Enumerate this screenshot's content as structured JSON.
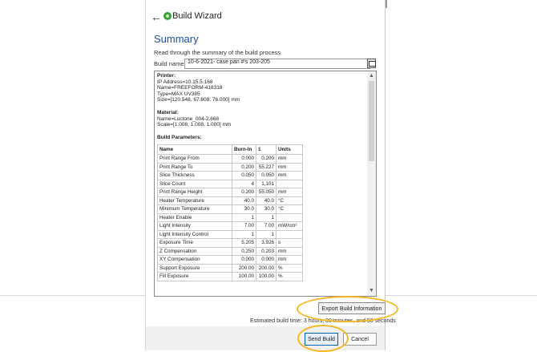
{
  "window": {
    "title": "Build Wizard"
  },
  "page": {
    "heading": "Summary",
    "subtext": "Read through the summary of the build process"
  },
  "build_name": {
    "label": "Build name:",
    "value": "10-6-2021- case pan #'s 203-205"
  },
  "printer": {
    "title": "Printer:",
    "lines": [
      "IP Address=10.15.5.168",
      "Name=FREEFORM-418318",
      "Type=MAX UV385",
      "Size=[120.548, 67.808, 76.000] mm"
    ]
  },
  "material": {
    "title": "Material:",
    "lines": [
      "Name=Luctone_004-2.668",
      "Scale=[1.008, 1.008, 1.000] mm"
    ]
  },
  "build_parameters": {
    "title": "Build Parameters:",
    "headers": [
      "Name",
      "Burn-In",
      "1",
      "Units"
    ],
    "rows": [
      [
        "Print Range From",
        "0.000",
        "0.200",
        "mm"
      ],
      [
        "Print Range To",
        "0.200",
        "55.227",
        "mm"
      ],
      [
        "Slice Thickness",
        "0.050",
        "0.050",
        "mm"
      ],
      [
        "Slice Count",
        "4",
        "1,101",
        ""
      ],
      [
        "Print Range Height",
        "0.200",
        "55.050",
        "mm"
      ],
      [
        "Heater Temperature",
        "40.0",
        "40.0",
        "°C"
      ],
      [
        "Minimum Temperature",
        "30.0",
        "30.0",
        "°C"
      ],
      [
        "Heater Enable",
        "1",
        "1",
        ""
      ],
      [
        "Light Intensity",
        "7.00",
        "7.00",
        "mW/cm²"
      ],
      [
        "Light Intensity Control",
        "1",
        "1",
        ""
      ],
      [
        "Exposure Time",
        "5.205",
        "3.926",
        "s"
      ],
      [
        "Z Compensation",
        "0.250",
        "0.203",
        "mm"
      ],
      [
        "XY Compensation",
        "0.000",
        "0.000",
        "mm"
      ],
      [
        "Support Exposure",
        "200.00",
        "200.00",
        "%"
      ],
      [
        "Fill Exposure",
        "100.00",
        "100.00",
        "%"
      ]
    ]
  },
  "buttons": {
    "export": "Export Build Information",
    "send": "Send Build",
    "cancel": "Cancel"
  },
  "estimate": "Estimated build time: 3 hours, 30 minutes, and 58 seconds",
  "icons": {
    "back": "back-arrow-icon",
    "app": "wizard-app-icon",
    "edit": "edit-name-icon"
  },
  "colors": {
    "heading": "#1f4e96",
    "highlight": "#f5b825",
    "primary_button_border": "#0063b1"
  }
}
